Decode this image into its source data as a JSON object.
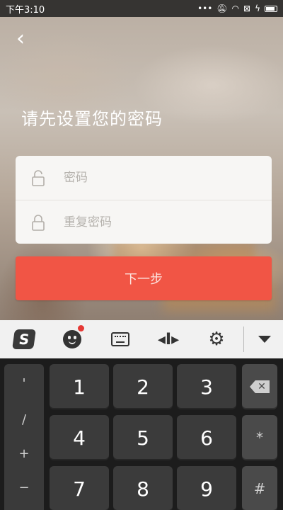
{
  "status_bar": {
    "time": "下午3:10",
    "icons": [
      "dots-icon",
      "mute-icon",
      "wifi-icon",
      "sim-icon",
      "charging-icon",
      "battery-icon"
    ]
  },
  "header": {
    "back_icon": "back-arrow-icon",
    "title": "请先设置您的密码"
  },
  "form": {
    "password_placeholder": "密码",
    "confirm_password_placeholder": "重复密码",
    "password_icon": "unlocked-lock-icon",
    "confirm_password_icon": "locked-lock-icon"
  },
  "next_button": {
    "label": "下一步",
    "color": "#f15545"
  },
  "keyboard": {
    "toolbar": [
      "sogou-logo-icon",
      "emoji-icon",
      "keyboard-icon",
      "cursor-move-icon",
      "gear-icon",
      "collapse-keyboard-icon"
    ],
    "symbols": [
      "'",
      "/",
      "+",
      "−"
    ],
    "digits": [
      "1",
      "2",
      "3",
      "4",
      "5",
      "6",
      "7",
      "8",
      "9"
    ],
    "function_keys": [
      "*",
      "#"
    ],
    "backspace_icon": "backspace-icon"
  }
}
